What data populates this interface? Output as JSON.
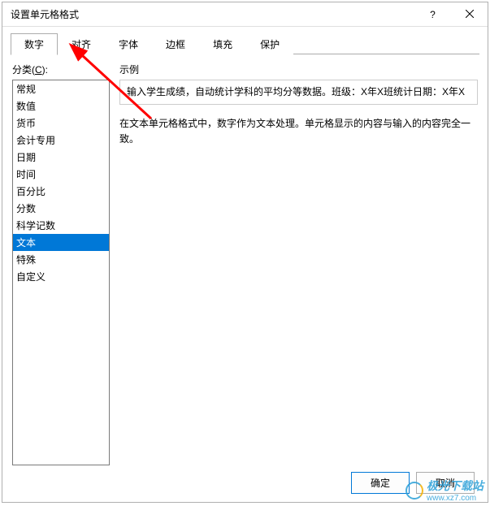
{
  "titlebar": {
    "title": "设置单元格格式"
  },
  "tabs": [
    {
      "label": "数字",
      "active": true
    },
    {
      "label": "对齐",
      "active": false
    },
    {
      "label": "字体",
      "active": false
    },
    {
      "label": "边框",
      "active": false
    },
    {
      "label": "填充",
      "active": false
    },
    {
      "label": "保护",
      "active": false
    }
  ],
  "category": {
    "label_prefix": "分类(",
    "label_key": "C",
    "label_suffix": "):",
    "items": [
      {
        "label": "常规",
        "selected": false
      },
      {
        "label": "数值",
        "selected": false
      },
      {
        "label": "货币",
        "selected": false
      },
      {
        "label": "会计专用",
        "selected": false
      },
      {
        "label": "日期",
        "selected": false
      },
      {
        "label": "时间",
        "selected": false
      },
      {
        "label": "百分比",
        "selected": false
      },
      {
        "label": "分数",
        "selected": false
      },
      {
        "label": "科学记数",
        "selected": false
      },
      {
        "label": "文本",
        "selected": true
      },
      {
        "label": "特殊",
        "selected": false
      },
      {
        "label": "自定义",
        "selected": false
      }
    ]
  },
  "sample": {
    "label": "示例",
    "value": "输入学生成绩，自动统计学科的平均分等数据。班级：X年X班统计日期：X年X"
  },
  "description": "在文本单元格格式中，数字作为文本处理。单元格显示的内容与输入的内容完全一致。",
  "buttons": {
    "ok": "确定",
    "cancel": "取消"
  },
  "watermark": {
    "text": "极光下载站",
    "sub": "www.xz7.com"
  },
  "annotation": {
    "arrow_color": "#ff0000"
  }
}
